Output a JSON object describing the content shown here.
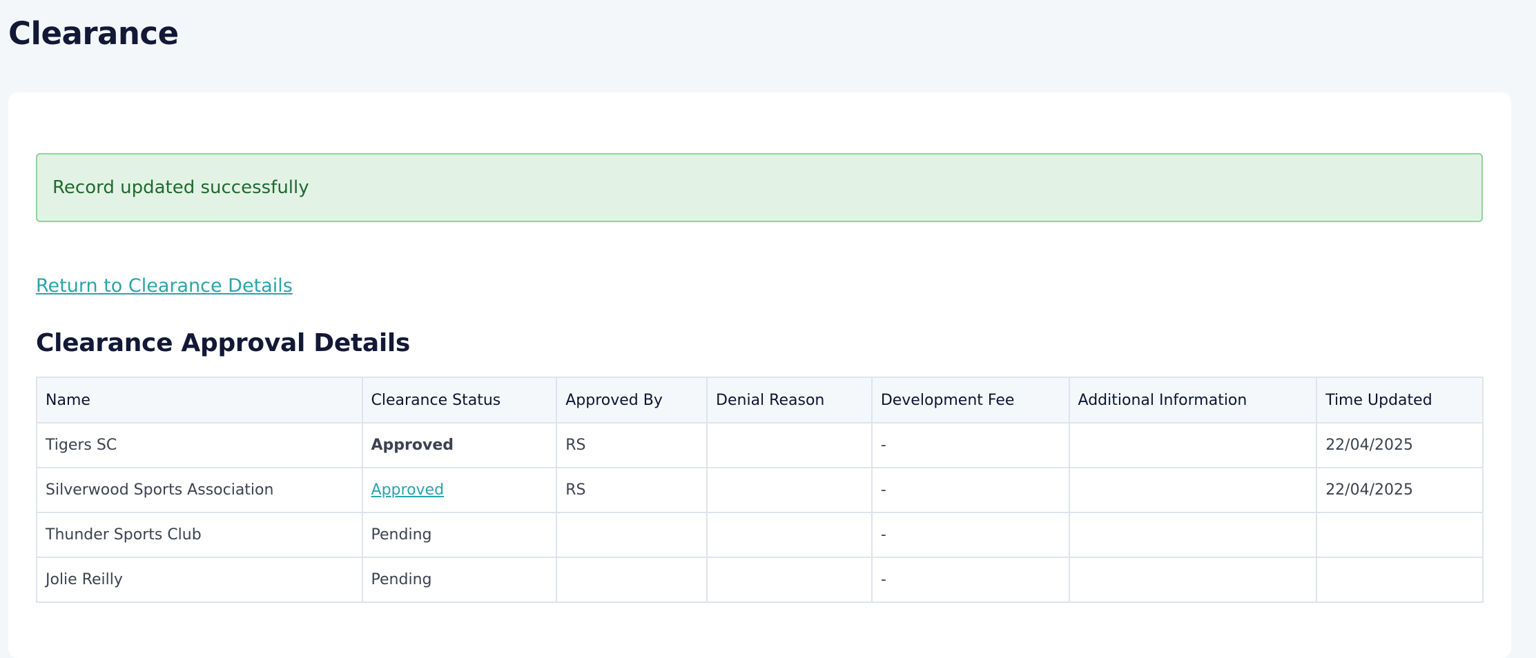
{
  "page": {
    "title": "Clearance"
  },
  "alert": {
    "message": "Record updated successfully",
    "color": "#e2f3e5"
  },
  "links": {
    "return_label": "Return to Clearance Details"
  },
  "section": {
    "heading": "Clearance Approval Details"
  },
  "table": {
    "columns": [
      "Name",
      "Clearance Status",
      "Approved By",
      "Denial Reason",
      "Development Fee",
      "Additional Information",
      "Time Updated"
    ],
    "rows": [
      {
        "name": "Tigers SC",
        "status": "Approved",
        "approved_by": "RS",
        "denial_reason": "",
        "development_fee": "-",
        "additional_info": "",
        "time_updated": "22/04/2025"
      },
      {
        "name": "Silverwood Sports Association",
        "status": "Approved",
        "approved_by": "RS",
        "denial_reason": "",
        "development_fee": "-",
        "additional_info": "",
        "time_updated": "22/04/2025"
      },
      {
        "name": "Thunder Sports Club",
        "status": "Pending",
        "approved_by": "",
        "denial_reason": "",
        "development_fee": "-",
        "additional_info": "",
        "time_updated": ""
      },
      {
        "name": "Jolie Reilly",
        "status": "Pending",
        "approved_by": "",
        "denial_reason": "",
        "development_fee": "-",
        "additional_info": "",
        "time_updated": ""
      }
    ]
  },
  "colors": {
    "link": "#2aa3ad",
    "approved": "#1b8a2a",
    "title": "#121836"
  }
}
